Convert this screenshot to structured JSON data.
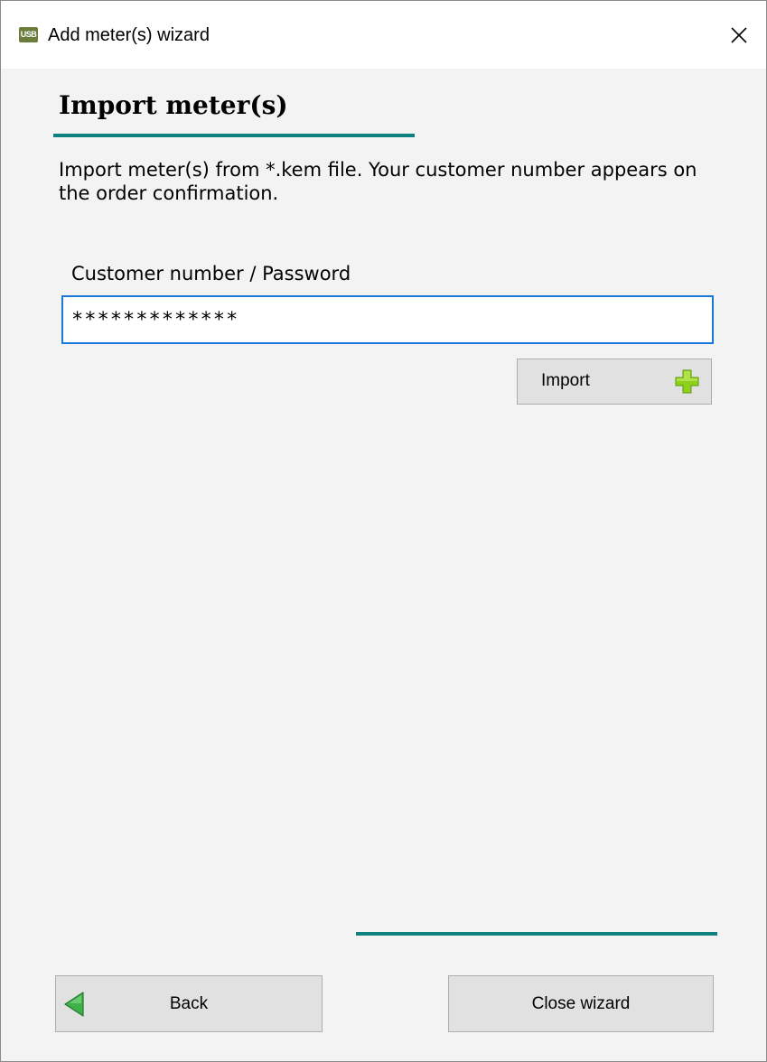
{
  "window": {
    "app_icon_text": "USB",
    "title": "Add meter(s) wizard"
  },
  "page": {
    "title": "Import meter(s)",
    "description": "Import meter(s) from *.kem file. Your customer number appears on the order confirmation."
  },
  "form": {
    "field_label": "Customer number / Password",
    "password_value": "*************"
  },
  "buttons": {
    "import_label": "Import",
    "back_label": "Back",
    "close_wizard_label": "Close wizard"
  },
  "colors": {
    "accent_teal": "#0e8080",
    "input_focus_border": "#1a78d8",
    "plus_green": "#8fd11a",
    "back_arrow_green": "#3fb14a"
  }
}
